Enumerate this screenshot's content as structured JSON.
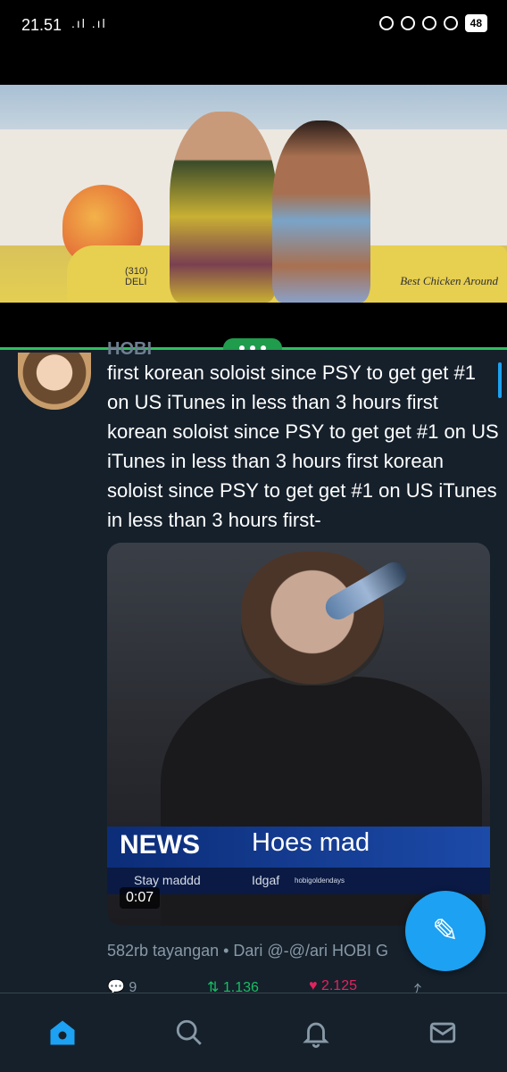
{
  "status_bar": {
    "time": "21.51",
    "signal": ".ıl .ıl",
    "battery": "48"
  },
  "tweet": {
    "username": "HOBI",
    "text": "first korean soloist since PSY to get get #1 on US iTunes in less than 3 hours first korean soloist since PSY to get get #1 on US iTunes in less than 3 hours first korean soloist since PSY to get get #1 on US iTunes in less than 3 hours first-",
    "media": {
      "news_label": "NEWS",
      "news_headline": "Hoes mad",
      "news_sub_left": "Stay maddd",
      "news_sub_mid": "Idgaf",
      "news_sub_right": "hobigoldendays",
      "duration": "0:07"
    },
    "views_line": "582rb tayangan • Dari @-@/ari HOBI G",
    "replies": "9",
    "retweets": "1.136",
    "likes": "2.125"
  },
  "video": {
    "car_text": "Best Chicken Around",
    "car_number": "(310)\nDELI"
  },
  "colors": {
    "background": "#15202b",
    "accent": "#1da1f2",
    "sheet_green": "#2fbf5e",
    "retweet": "#17bf63",
    "like": "#e0245e"
  },
  "nav": [
    "home-icon",
    "search-icon",
    "notifications-icon",
    "messages-icon"
  ]
}
